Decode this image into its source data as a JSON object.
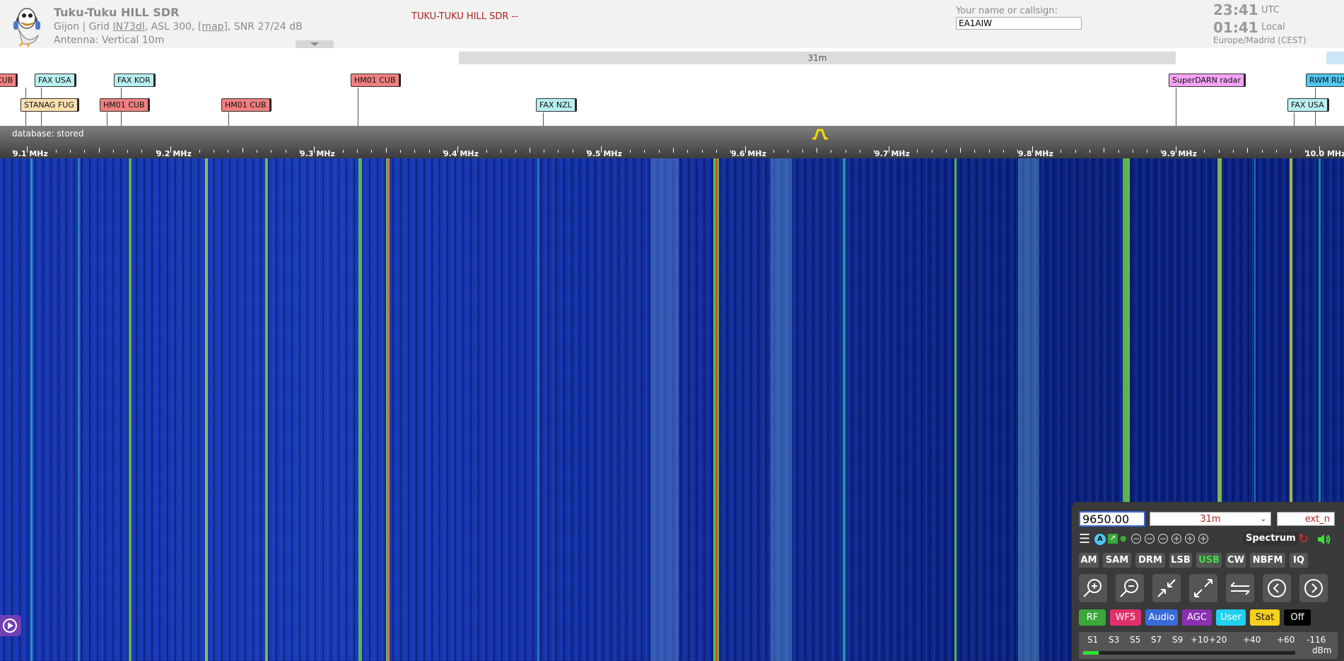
{
  "header": {
    "title": "Tuku-Tuku HILL SDR",
    "location_prefix": "Gijon | Grid ",
    "grid": "IN73dl",
    "asl": ", ASL 300, ",
    "map_link": "[map]",
    "snr": ", SNR 27/24 dB",
    "antenna": "Antenna: Vertical 10m",
    "banner": "TUKU-TUKU HILL SDR --",
    "callsign_label": "Your name or callsign:",
    "callsign_value": "EA1AIW",
    "utc_time": "23:41",
    "utc_label": "UTC",
    "local_time": "01:41",
    "local_label": "Local",
    "timezone": "Europe/Madrid (CEST)"
  },
  "band_bar": {
    "label": "31m"
  },
  "stations": [
    {
      "label": "CUB",
      "color": "#f08080"
    },
    {
      "label": "FAX USA",
      "color": "#b8f0f0"
    },
    {
      "label": "FAX KOR",
      "color": "#b8f0f0"
    },
    {
      "label": "HM01 CUB",
      "color": "#f08080"
    },
    {
      "label": "SuperDARN radar",
      "color": "#f5a3f5"
    },
    {
      "label": "RWM RUS",
      "color": "#4fc8f0"
    },
    {
      "label": "STANAG FUG",
      "color": "#fde0b0"
    },
    {
      "label": "HM01 CUB",
      "color": "#f08080"
    },
    {
      "label": "HM01 CUB",
      "color": "#f08080"
    },
    {
      "label": "FAX NZL",
      "color": "#b8f0f0"
    },
    {
      "label": "FAX USA",
      "color": "#b8f0f0"
    }
  ],
  "scale": {
    "database": "database: stored",
    "freq_labels": [
      "9.1 MHz",
      "9.2 MHz",
      "9.3 MHz",
      "9.4 MHz",
      "9.5 MHz",
      "9.6 MHz",
      "9.7 MHz",
      "9.8 MHz",
      "9.9 MHz",
      "10.0 MHz"
    ]
  },
  "control_panel": {
    "frequency": "9650.00",
    "band": "31m",
    "extension": "ext_n",
    "spectrum_label": "Spectrum",
    "modes": [
      "AM",
      "SAM",
      "DRM",
      "LSB",
      "USB",
      "CW",
      "NBFM",
      "IQ"
    ],
    "selected_mode": "USB",
    "tabs": [
      {
        "label": "RF",
        "bg": "#3aa83a",
        "fg": "#ffffff"
      },
      {
        "label": "WF5",
        "bg": "#e0306a",
        "fg": "#ffffff"
      },
      {
        "label": "Audio",
        "bg": "#3a6ad8",
        "fg": "#ffffff"
      },
      {
        "label": "AGC",
        "bg": "#8a30b0",
        "fg": "#ffffff"
      },
      {
        "label": "User",
        "bg": "#20d0f0",
        "fg": "#ffffff"
      },
      {
        "label": "Stat",
        "bg": "#f5d020",
        "fg": "#111111"
      },
      {
        "label": "Off",
        "bg": "#000000",
        "fg": "#ffffff"
      }
    ],
    "smeter_labels": [
      "S1",
      "S3",
      "S5",
      "S7",
      "S9",
      "+10",
      "+20",
      "+40",
      "+60"
    ],
    "smeter_value": "-116",
    "smeter_unit": "dBm"
  }
}
